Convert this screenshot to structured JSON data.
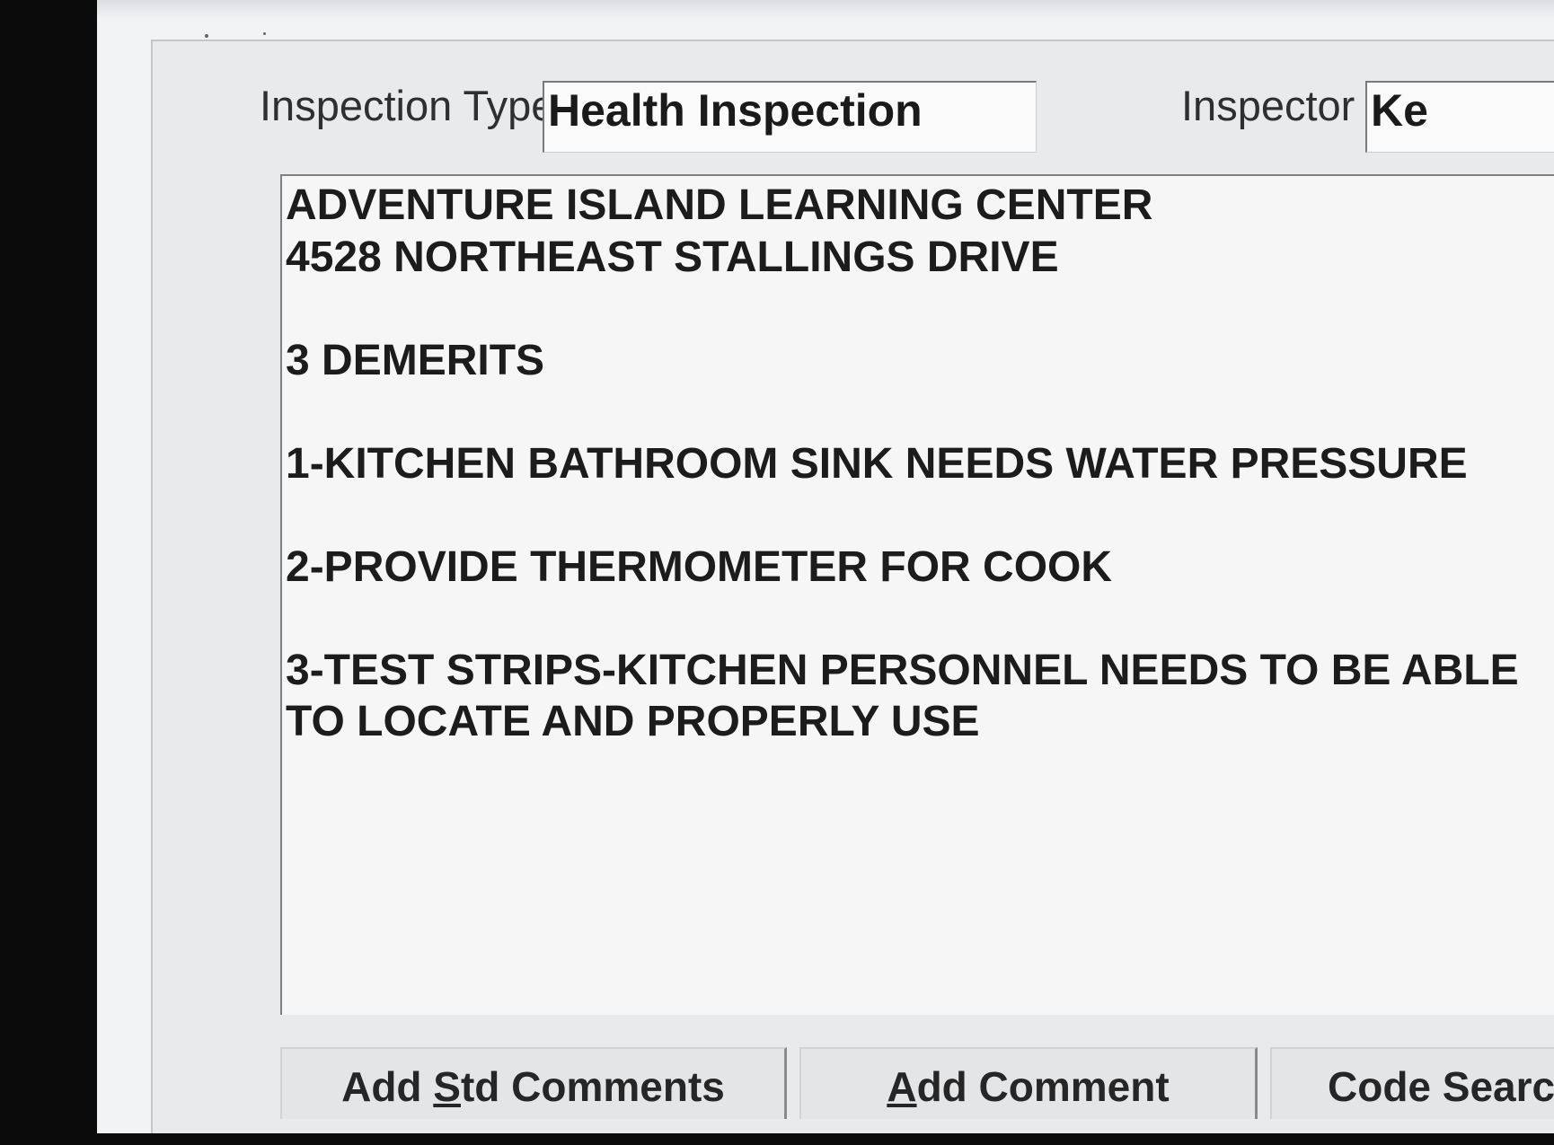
{
  "form": {
    "inspection_type_label": "Inspection Type",
    "inspection_type_value": "Health Inspection",
    "inspector_label": "Inspector",
    "inspector_value": "Ke"
  },
  "comments": {
    "text": "ADVENTURE ISLAND LEARNING CENTER\n4528 NORTHEAST STALLINGS DRIVE\n\n3 DEMERITS\n\n1-KITCHEN BATHROOM SINK NEEDS WATER PRESSURE\n\n2-PROVIDE THERMOMETER FOR COOK\n\n3-TEST STRIPS-KITCHEN PERSONNEL NEEDS TO BE ABLE\nTO LOCATE AND PROPERLY USE"
  },
  "buttons": {
    "add_std_comments": {
      "before": "Add ",
      "mnemonic": "S",
      "after": "td Comments"
    },
    "add_comment": {
      "before": "",
      "mnemonic": "A",
      "after": "dd Comment"
    },
    "code_search": {
      "label": "Code Search Li"
    }
  }
}
